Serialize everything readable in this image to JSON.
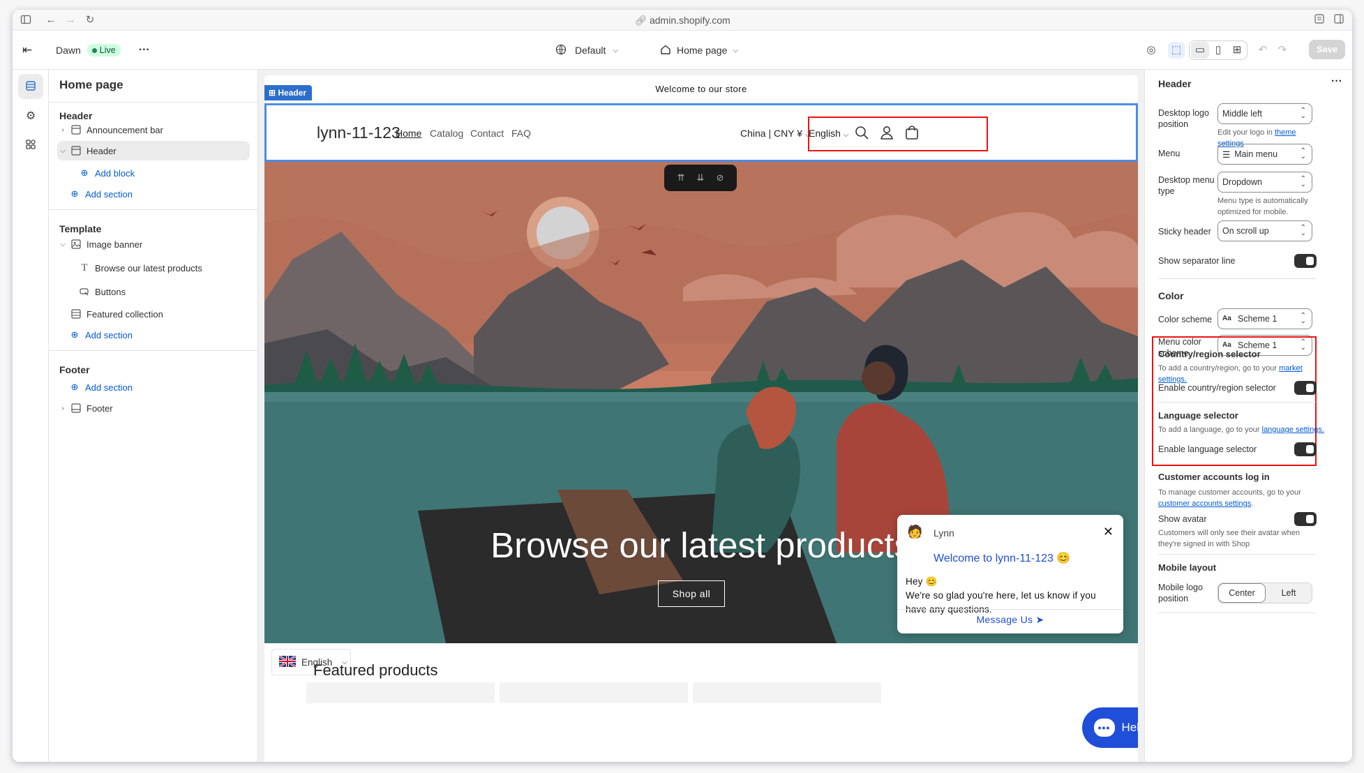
{
  "browser": {
    "url": "admin.shopify.com"
  },
  "topbar": {
    "theme_name": "Dawn",
    "live_label": "Live",
    "more": "···",
    "view_label": "Default",
    "page_label": "Home page",
    "save_label": "Save"
  },
  "left": {
    "title": "Home page",
    "header_group": "Header",
    "header_items": [
      "Announcement bar",
      "Header"
    ],
    "add_block": "Add block",
    "add_section": "Add section",
    "template_group": "Template",
    "template_items": [
      "Image banner",
      "Browse our latest products",
      "Buttons",
      "Featured collection"
    ],
    "footer_group": "Footer",
    "footer_items": [
      "Footer"
    ]
  },
  "preview": {
    "announcement": "Welcome to our store",
    "header_tag": "Header",
    "logo": "lynn-11-123",
    "nav": [
      "Home",
      "Catalog",
      "Contact",
      "FAQ"
    ],
    "country": "China | CNY ¥",
    "language": "English",
    "hero_title": "Browse our latest products",
    "hero_button": "Shop all",
    "lang_picker": "English",
    "featured_title": "Featured products",
    "chat": {
      "name": "Lynn",
      "welcome": "Welcome to lynn-11-123 😊",
      "line1": "Hey 😊",
      "line2": "We're so glad you're here, let us know if you have any questions.",
      "send": "Message Us"
    },
    "help_label": "Help"
  },
  "right": {
    "title": "Header",
    "logo_pos_label": "Desktop logo position",
    "logo_pos_value": "Middle left",
    "logo_help_pre": "Edit your logo in",
    "logo_help_link": "theme settings",
    "menu_label": "Menu",
    "menu_value": "Main menu",
    "menu_type_label": "Desktop menu type",
    "menu_type_value": "Dropdown",
    "menu_type_help": "Menu type is automatically optimized for mobile.",
    "sticky_label": "Sticky header",
    "sticky_value": "On scroll up",
    "separator_label": "Show separator line",
    "color_title": "Color",
    "color_scheme_label": "Color scheme",
    "color_scheme_value": "Scheme 1",
    "menu_color_label": "Menu color scheme",
    "menu_color_value": "Scheme 1",
    "country_title": "Country/region selector",
    "country_note_pre": "To add a country/region, go to your",
    "country_note_link": "market settings.",
    "country_toggle": "Enable country/region selector",
    "lang_title": "Language selector",
    "lang_note_pre": "To add a language, go to your",
    "lang_note_link": "language settings.",
    "lang_toggle": "Enable language selector",
    "accounts_title": "Customer accounts log in",
    "accounts_note_pre": "To manage customer accounts, go to your",
    "accounts_note_link": "customer accounts settings",
    "avatar_label": "Show avatar",
    "avatar_note": "Customers will only see their avatar when they're signed in with Shop",
    "mobile_title": "Mobile layout",
    "mobile_logo_label": "Mobile logo position",
    "mobile_center": "Center",
    "mobile_left": "Left"
  }
}
